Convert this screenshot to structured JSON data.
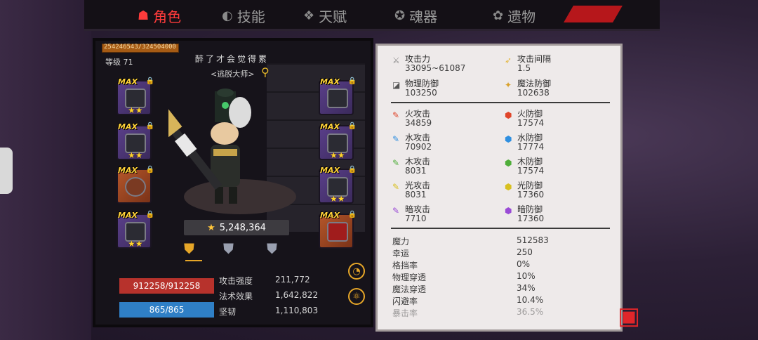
{
  "tabs": [
    {
      "label": "角色",
      "icon": "character-icon",
      "active": true
    },
    {
      "label": "技能",
      "icon": "skill-icon",
      "active": false
    },
    {
      "label": "天赋",
      "icon": "talent-icon",
      "active": false
    },
    {
      "label": "魂器",
      "icon": "soul-icon",
      "active": false
    },
    {
      "label": "遗物",
      "icon": "relic-icon",
      "active": false
    }
  ],
  "hero": {
    "xp": "254246543/324504000",
    "level": "等级 71",
    "title": "醉了才会觉得累",
    "subtitle": "<逃脱大师>",
    "power": "5,248,364"
  },
  "equipment": {
    "max_label": "MAX",
    "stars": "★★"
  },
  "bars": {
    "hp": "912258/912258",
    "mp": "865/865"
  },
  "bottom_stats": [
    {
      "label": "攻击强度",
      "value": "211,772"
    },
    {
      "label": "法术效果",
      "value": "1,642,822"
    },
    {
      "label": "坚韧",
      "value": "1,110,803"
    }
  ],
  "panel": {
    "top": [
      {
        "label": "攻击力",
        "value": "33095~61087",
        "icon": "sword-icon",
        "color": "#9a9a9a"
      },
      {
        "label": "攻击间隔",
        "value": "1.5",
        "icon": "speed-icon",
        "color": "#e3b53a"
      },
      {
        "label": "物理防御",
        "value": "103250",
        "icon": "armor-icon",
        "color": "#6b6b6b"
      },
      {
        "label": "魔法防御",
        "value": "102638",
        "icon": "magic-shield-icon",
        "color": "#d9a12a"
      }
    ],
    "elements": [
      {
        "label": "火攻击",
        "value": "34859",
        "icon": "fire-attack-icon",
        "color": "#e0452a"
      },
      {
        "label": "火防御",
        "value": "17574",
        "icon": "fire-defense-icon",
        "color": "#e0452a"
      },
      {
        "label": "水攻击",
        "value": "70902",
        "icon": "water-attack-icon",
        "color": "#2f8fe0"
      },
      {
        "label": "水防御",
        "value": "17774",
        "icon": "water-defense-icon",
        "color": "#2f8fe0"
      },
      {
        "label": "木攻击",
        "value": "8031",
        "icon": "wood-attack-icon",
        "color": "#4fae3a"
      },
      {
        "label": "木防御",
        "value": "17574",
        "icon": "wood-defense-icon",
        "color": "#4fae3a"
      },
      {
        "label": "光攻击",
        "value": "8031",
        "icon": "light-attack-icon",
        "color": "#e8d02a"
      },
      {
        "label": "光防御",
        "value": "17360",
        "icon": "light-defense-icon",
        "color": "#e8d02a"
      },
      {
        "label": "暗攻击",
        "value": "7710",
        "icon": "dark-attack-icon",
        "color": "#9a4bd6"
      },
      {
        "label": "暗防御",
        "value": "17360",
        "icon": "dark-defense-icon",
        "color": "#9a4bd6"
      }
    ],
    "misc": [
      {
        "label": "魔力",
        "value": "512583"
      },
      {
        "label": "幸运",
        "value": "250"
      },
      {
        "label": "格挡率",
        "value": "0%"
      },
      {
        "label": "物理穿透",
        "value": "10%"
      },
      {
        "label": "魔法穿透",
        "value": "34%"
      },
      {
        "label": "闪避率",
        "value": "10.4%"
      },
      {
        "label": "暴击率",
        "value": "36.5%"
      }
    ]
  }
}
